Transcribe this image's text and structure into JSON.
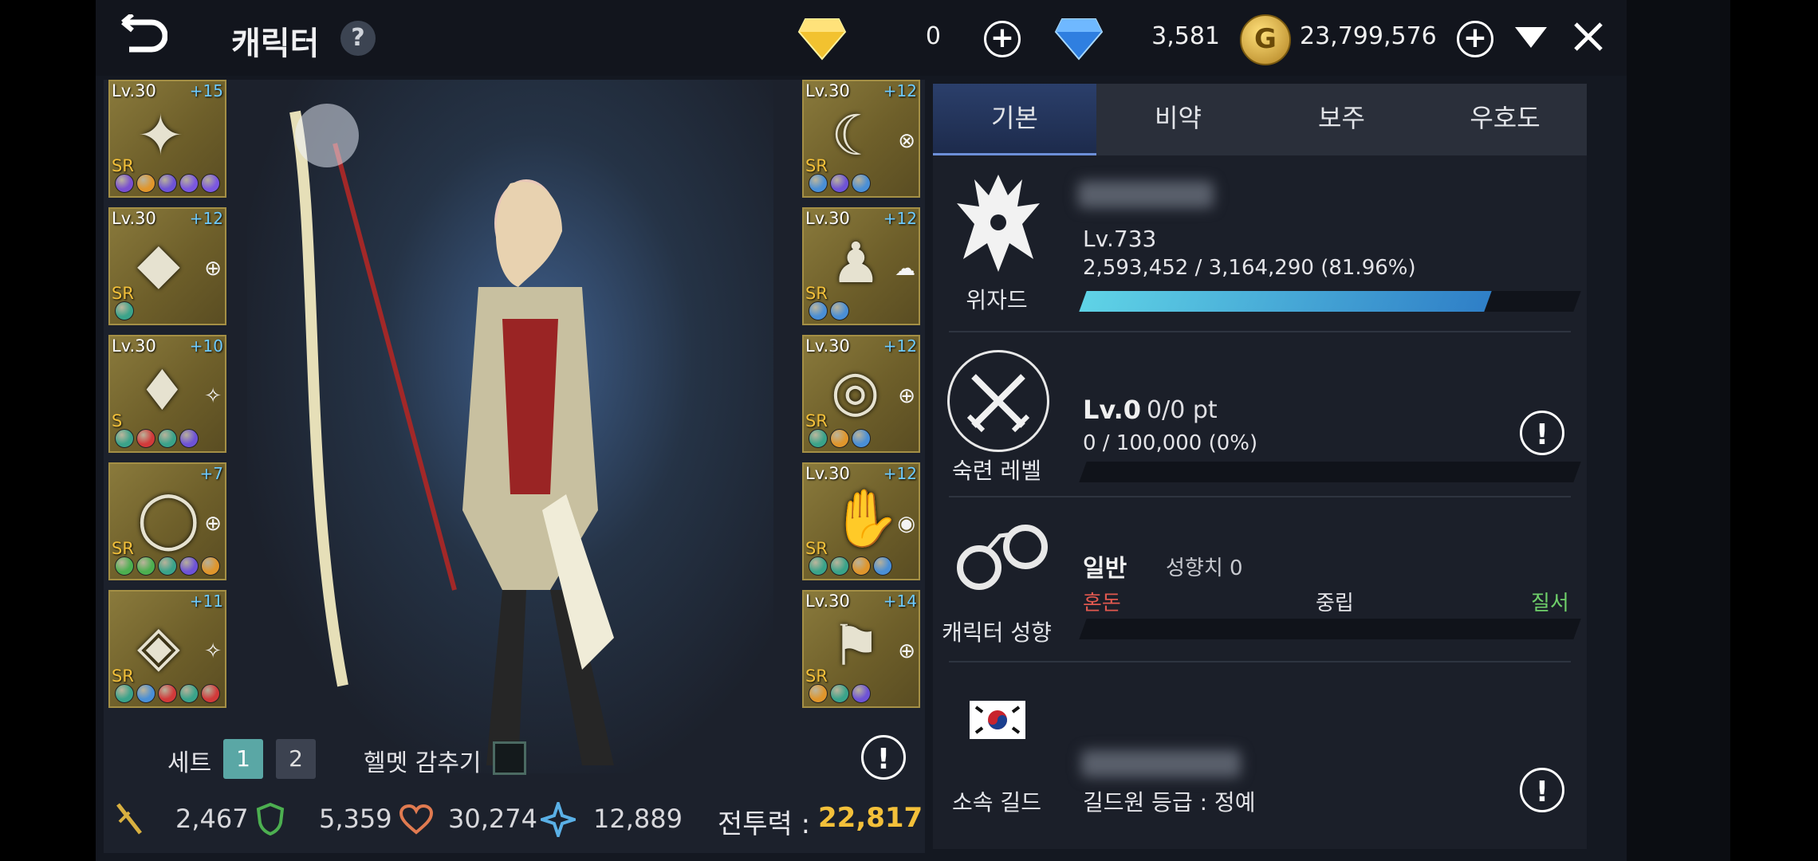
{
  "header": {
    "title": "캐릭터",
    "help": "?"
  },
  "currency": {
    "gem_yellow": "0",
    "gem_blue": "3,581",
    "gold": "23,799,576"
  },
  "left_slots": [
    {
      "lv": "Lv.30",
      "plus": "+15",
      "grade": "SR",
      "gems": [
        "#7a4fd0",
        "#e0962c",
        "#6e53d6",
        "#7b57e0",
        "#7b57e0"
      ],
      "icon": "✦",
      "mark": ""
    },
    {
      "lv": "Lv.30",
      "plus": "+12",
      "grade": "SR",
      "gems": [
        "#3aa38a"
      ],
      "icon": "◆",
      "mark": "⊕"
    },
    {
      "lv": "Lv.30",
      "plus": "+10",
      "grade": "S",
      "gems": [
        "#3aa38a",
        "#d23a3a",
        "#3aa38a",
        "#6e53d6"
      ],
      "icon": "♦",
      "mark": "✧"
    },
    {
      "lv": "",
      "plus": "+7",
      "grade": "SR",
      "gems": [
        "#4caf50",
        "#4caf50",
        "#3aa38a",
        "#6e53d6",
        "#e0962c"
      ],
      "icon": "◯",
      "mark": "⊕"
    },
    {
      "lv": "",
      "plus": "+11",
      "grade": "SR",
      "gems": [
        "#3aa38a",
        "#4a8fd6",
        "#d23a3a",
        "#3aa38a",
        "#d23a3a"
      ],
      "icon": "◈",
      "mark": "✧"
    }
  ],
  "right_slots": [
    {
      "lv": "Lv.30",
      "plus": "+12",
      "grade": "SR",
      "gems": [
        "#4a8fd6",
        "#6e53d6",
        "#4a8fd6"
      ],
      "icon": "☾",
      "mark": "⊗"
    },
    {
      "lv": "Lv.30",
      "plus": "+12",
      "grade": "SR",
      "gems": [
        "#4a8fd6",
        "#4a8fd6"
      ],
      "icon": "♟",
      "mark": "☁"
    },
    {
      "lv": "Lv.30",
      "plus": "+12",
      "grade": "SR",
      "gems": [
        "#3aa38a",
        "#e0962c",
        "#4a8fd6"
      ],
      "icon": "◎",
      "mark": "⊕"
    },
    {
      "lv": "Lv.30",
      "plus": "+12",
      "grade": "SR",
      "gems": [
        "#3aa38a",
        "#3aa38a",
        "#e0962c",
        "#4a8fd6"
      ],
      "icon": "✋",
      "mark": "◉"
    },
    {
      "lv": "Lv.30",
      "plus": "+14",
      "grade": "SR",
      "gems": [
        "#e0962c",
        "#3aa38a",
        "#6e53d6"
      ],
      "icon": "⚑",
      "mark": "⊕"
    }
  ],
  "set": {
    "label": "세트",
    "btn1": "1",
    "btn2": "2",
    "helmet_label": "헬멧 감추기"
  },
  "stats": {
    "attack": "2,467",
    "defense": "5,359",
    "hp": "30,274",
    "magic": "12,889",
    "power_label": "전투력 :",
    "power": "22,817"
  },
  "tabs": [
    "기본",
    "비약",
    "보주",
    "우호도"
  ],
  "class": {
    "name": "위자드",
    "level": "Lv.733",
    "exp": "2,593,452 / 3,164,290 (81.96%)",
    "progress": 0.8196
  },
  "mastery": {
    "label": "숙련 레벨",
    "level": "Lv.0",
    "pt": "0/0 pt",
    "exp": "0 / 100,000 (0%)",
    "progress": 0
  },
  "alignment": {
    "label": "캐릭터 성향",
    "type": "일반",
    "value_label": "성향치 0",
    "chaos": "혼돈",
    "neutral": "중립",
    "order": "질서"
  },
  "guild": {
    "label": "소속 길드",
    "rank": "길드원 등급 : 정예"
  },
  "colors": {
    "accent": "#2f7fc7",
    "gold": "#f3c03a",
    "chaos": "#e0584f",
    "order": "#6fd06a"
  }
}
